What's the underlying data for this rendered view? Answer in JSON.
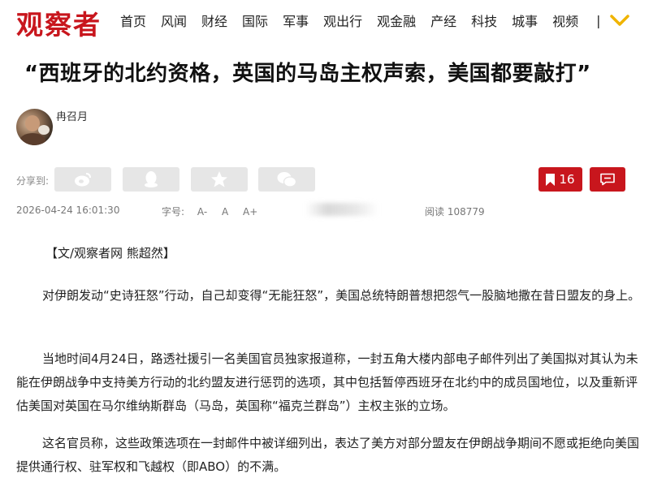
{
  "header": {
    "logo": "观察者",
    "nav": [
      "首页",
      "风闻",
      "财经",
      "国际",
      "军事",
      "观出行",
      "观金融",
      "产经",
      "科技",
      "城事",
      "视频"
    ],
    "separator": "|"
  },
  "article": {
    "title": "“西班牙的北约资格，英国的马岛主权声索，美国都要敲打”",
    "author": "冉召月",
    "share_label": "分享到:",
    "bookmark_count": "16",
    "date": "2026-04-24 16:01:30",
    "font_size_label": "字号:",
    "font_size_options": [
      "A-",
      "A",
      "A+"
    ],
    "reads": "阅读 108779",
    "paragraphs": [
      "【文/观察者网 熊超然】",
      "对伊朗发动“史诗狂怒”行动，自己却变得“无能狂怒”，美国总统特朗普想把怨气一股脑地撒在昔日盟友的身上。",
      "当地时间4月24日，路透社援引一名美国官员独家报道称，一封五角大楼内部电子邮件列出了美国拟对其认为未能在伊朗战争中支持美方行动的北约盟友进行惩罚的选项，其中包括暂停西班牙在北约中的成员国地位，以及重新评估美国对英国在马尔维纳斯群岛（马岛，英国称“福克兰群岛”）主权主张的立场。",
      "这名官员称，这些政策选项在一封邮件中被详细列出，表达了美方对部分盟友在伊朗战争期间不愿或拒绝向美国提供通行权、驻军权和飞越权（即ABO）的不满。"
    ]
  },
  "colors": {
    "brand": "#c8161d",
    "share_bg": "#e6e6e6"
  },
  "icons": [
    "weibo-icon",
    "qq-icon",
    "qzone-star-icon",
    "wechat-icon",
    "bookmark-icon",
    "comment-icon",
    "chevron-down-icon"
  ]
}
